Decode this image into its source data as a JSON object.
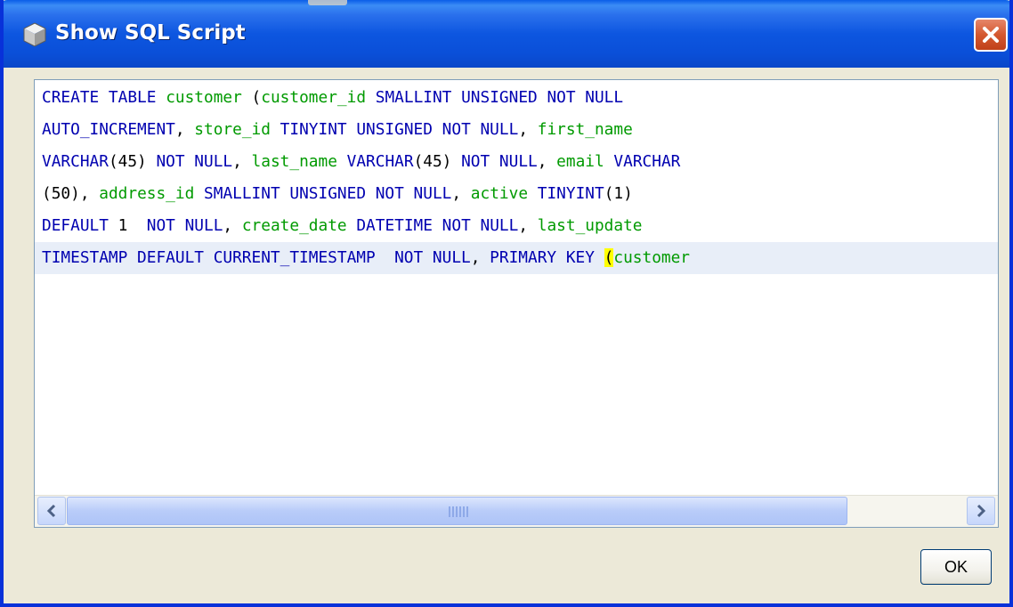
{
  "window": {
    "title": "Show SQL Script",
    "icon": "sql-cube-icon",
    "close_icon": "close-icon"
  },
  "sql": {
    "lines": [
      [
        {
          "t": "CREATE TABLE",
          "k": "kw"
        },
        {
          "t": " ",
          "k": "punc"
        },
        {
          "t": "customer",
          "k": "id"
        },
        {
          "t": " (",
          "k": "punc"
        },
        {
          "t": "customer_id",
          "k": "id"
        },
        {
          "t": " ",
          "k": "punc"
        },
        {
          "t": "SMALLINT UNSIGNED NOT NULL",
          "k": "kw"
        }
      ],
      [
        {
          "t": "AUTO_INCREMENT",
          "k": "kw"
        },
        {
          "t": ", ",
          "k": "punc"
        },
        {
          "t": "store_id",
          "k": "id"
        },
        {
          "t": " ",
          "k": "punc"
        },
        {
          "t": "TINYINT UNSIGNED NOT NULL",
          "k": "kw"
        },
        {
          "t": ", ",
          "k": "punc"
        },
        {
          "t": "first_name",
          "k": "id"
        }
      ],
      [
        {
          "t": "VARCHAR",
          "k": "kw"
        },
        {
          "t": "(45) ",
          "k": "num"
        },
        {
          "t": "NOT NULL",
          "k": "kw"
        },
        {
          "t": ", ",
          "k": "punc"
        },
        {
          "t": "last_name",
          "k": "id"
        },
        {
          "t": " ",
          "k": "punc"
        },
        {
          "t": "VARCHAR",
          "k": "kw"
        },
        {
          "t": "(45) ",
          "k": "num"
        },
        {
          "t": "NOT NULL",
          "k": "kw"
        },
        {
          "t": ", ",
          "k": "punc"
        },
        {
          "t": "email",
          "k": "id"
        },
        {
          "t": " ",
          "k": "punc"
        },
        {
          "t": "VARCHAR",
          "k": "kw"
        }
      ],
      [
        {
          "t": "(50)",
          "k": "num"
        },
        {
          "t": ", ",
          "k": "punc"
        },
        {
          "t": "address_id",
          "k": "id"
        },
        {
          "t": " ",
          "k": "punc"
        },
        {
          "t": "SMALLINT UNSIGNED NOT NULL",
          "k": "kw"
        },
        {
          "t": ", ",
          "k": "punc"
        },
        {
          "t": "active",
          "k": "id"
        },
        {
          "t": " ",
          "k": "punc"
        },
        {
          "t": "TINYINT",
          "k": "kw"
        },
        {
          "t": "(1)",
          "k": "num"
        }
      ],
      [
        {
          "t": "DEFAULT",
          "k": "kw"
        },
        {
          "t": " 1  ",
          "k": "num"
        },
        {
          "t": "NOT NULL",
          "k": "kw"
        },
        {
          "t": ", ",
          "k": "punc"
        },
        {
          "t": "create_date",
          "k": "id"
        },
        {
          "t": " ",
          "k": "punc"
        },
        {
          "t": "DATETIME NOT NULL",
          "k": "kw"
        },
        {
          "t": ", ",
          "k": "punc"
        },
        {
          "t": "last_update",
          "k": "id"
        }
      ],
      [
        {
          "t": "TIMESTAMP DEFAULT CURRENT_TIMESTAMP  NOT NULL",
          "k": "kw"
        },
        {
          "t": ", ",
          "k": "punc"
        },
        {
          "t": "PRIMARY KEY",
          "k": "kw"
        },
        {
          "t": " ",
          "k": "punc"
        },
        {
          "t": "(",
          "k": "caret"
        },
        {
          "t": "customer",
          "k": "id"
        }
      ]
    ],
    "current_line": 5
  },
  "scrollbar": {
    "left_icon": "scroll-left-arrow-icon",
    "right_icon": "scroll-right-arrow-icon",
    "grip_icon": "scroll-grip-icon",
    "thumb_fraction": 0.87,
    "position_fraction": 0.0
  },
  "buttons": {
    "ok_label": "OK"
  }
}
